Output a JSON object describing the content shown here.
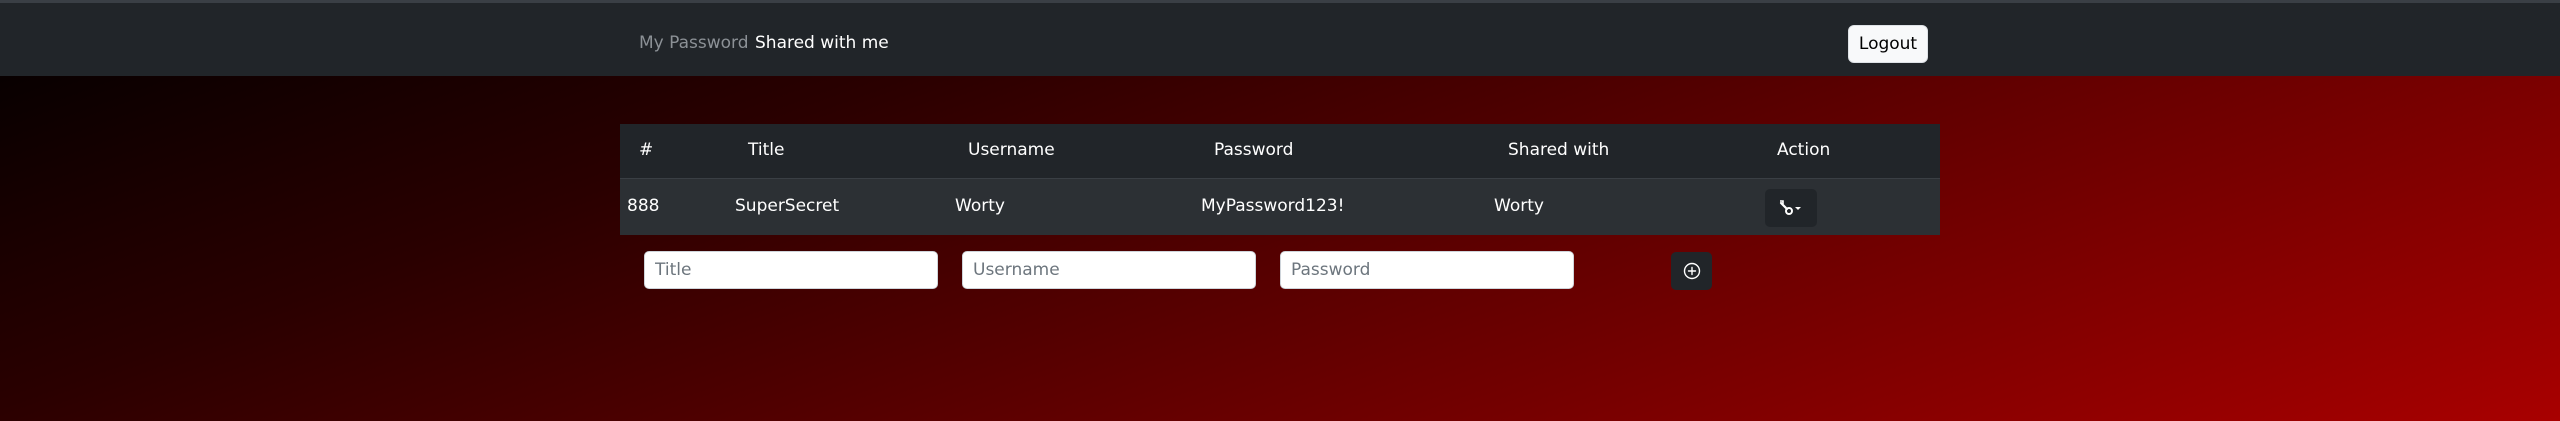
{
  "nav": {
    "my_password": "My Password",
    "shared_with_me": "Shared with me",
    "logout": "Logout"
  },
  "table": {
    "headers": [
      "#",
      "Title",
      "Username",
      "Password",
      "Shared with",
      "Action"
    ],
    "rows": [
      {
        "id": "888",
        "title": "SuperSecret",
        "username": "Worty",
        "password": "MyPassword123!",
        "shared_with": "Worty",
        "action_icon": "wrench-icon"
      }
    ]
  },
  "form": {
    "title_placeholder": "Title",
    "username_placeholder": "Username",
    "password_placeholder": "Password",
    "add_icon": "plus-circle-icon"
  },
  "colors": {
    "navbar": "#212529",
    "table_header": "#212529",
    "table_row": "#2c3034",
    "gradient_end": "#a80000"
  }
}
